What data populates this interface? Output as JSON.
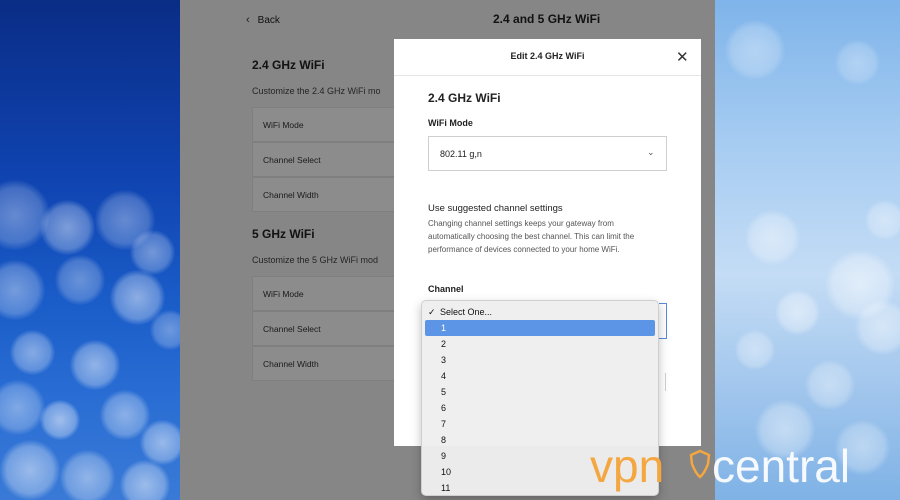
{
  "app": {
    "back_label": "Back",
    "title": "2.4 and 5 GHz WiFi",
    "sections": [
      {
        "title": "2.4 GHz WiFi",
        "desc": "Customize the 2.4 GHz WiFi mo",
        "rows": [
          "WiFi Mode",
          "Channel Select",
          "Channel Width"
        ]
      },
      {
        "title": "5 GHz WiFi",
        "desc": "Customize the 5 GHz WiFi mod",
        "rows": [
          "WiFi Mode",
          "Channel Select",
          "Channel Width"
        ]
      }
    ]
  },
  "modal": {
    "title": "Edit 2.4 GHz WiFi",
    "heading": "2.4 GHz WiFi",
    "wifi_mode_label": "WiFi Mode",
    "wifi_mode_value": "802.11 g,n",
    "suggested_label": "Use suggested channel settings",
    "suggested_help": "Changing channel settings keeps your gateway from automatically choosing the best channel. This can limit the performance of devices connected to your home WiFi.",
    "channel_label": "Channel"
  },
  "dropdown": {
    "selected": "Select One...",
    "highlighted": "1",
    "options": [
      "Select One...",
      "1",
      "2",
      "3",
      "4",
      "5",
      "6",
      "7",
      "8",
      "9",
      "10",
      "11"
    ]
  },
  "watermark": {
    "part1": "vpn",
    "part2": "central"
  },
  "colors": {
    "highlight": "#5c95e6",
    "watermark_orange": "#f4a640"
  }
}
